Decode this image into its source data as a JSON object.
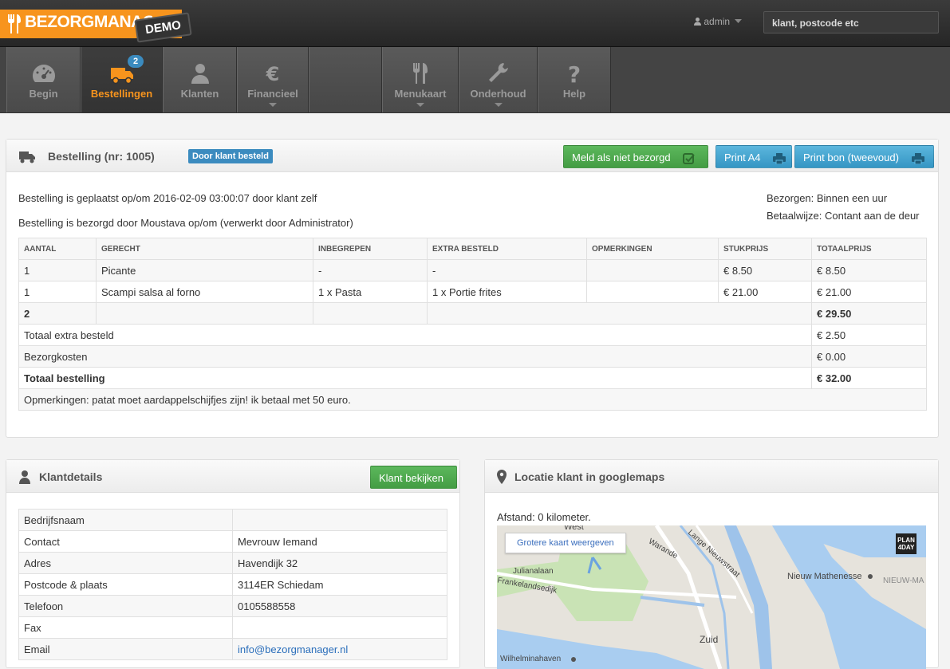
{
  "topbar": {
    "brand": "BEZORGMANAGER",
    "demo": "DEMO",
    "user": "admin",
    "search_placeholder": "klant, postcode etc"
  },
  "nav": {
    "items": [
      {
        "label": "Begin",
        "icon": "dashboard-icon"
      },
      {
        "label": "Bestellingen",
        "icon": "truck-icon",
        "badge": "2",
        "active": true
      },
      {
        "label": "Klanten",
        "icon": "user-icon"
      },
      {
        "label": "Financieel",
        "icon": "euro-icon"
      },
      {
        "label": "Menukaart",
        "icon": "cutlery-icon"
      },
      {
        "label": "Onderhoud",
        "icon": "wrench-icon"
      },
      {
        "label": "Help",
        "icon": "question-icon"
      }
    ]
  },
  "order": {
    "title": "Bestelling (nr: 1005)",
    "status_label": "Door klant besteld",
    "btn_not_delivered": "Meld als niet bezorgd",
    "btn_print_a4": "Print A4",
    "btn_print_receipt": "Print bon (tweevoud)",
    "placed_text": "Bestelling is geplaatst op/om 2016-02-09 03:00:07 door klant zelf",
    "delivered_text": "Bestelling is bezorgd door Moustava op/om (verwerkt door Administrator)",
    "delivery": "Bezorgen: Binnen een uur",
    "payment": "Betaalwijze: Contant aan de deur",
    "columns": [
      "AANTAL",
      "GERECHT",
      "INBEGREPEN",
      "EXTRA BESTELD",
      "OPMERKINGEN",
      "STUKPRIJS",
      "TOTAALPRIJS"
    ],
    "rows": [
      [
        "1",
        "Picante",
        "-",
        "-",
        "",
        "€ 8.50",
        "€ 8.50"
      ],
      [
        "1",
        "Scampi salsa al forno",
        "1 x Pasta",
        "1 x Portie frites",
        "",
        "€ 21.00",
        "€ 21.00"
      ]
    ],
    "subtotal_qty": "2",
    "subtotal": "€ 29.50",
    "extra_label": "Totaal extra besteld",
    "extra_value": "€ 2.50",
    "delivery_cost_label": "Bezorgkosten",
    "delivery_cost_value": "€ 0.00",
    "total_label": "Totaal bestelling",
    "total_value": "€ 32.00",
    "remarks": "Opmerkingen: patat moet aardappelschijfjes zijn! ik betaal met 50 euro."
  },
  "customer": {
    "title": "Klantdetails",
    "btn_view": "Klant bekijken",
    "rows": [
      {
        "label": "Bedrijfsnaam",
        "value": ""
      },
      {
        "label": "Contact",
        "value": "Mevrouw Iemand"
      },
      {
        "label": "Adres",
        "value": "Havendijk 32"
      },
      {
        "label": "Postcode & plaats",
        "value": "3114ER Schiedam"
      },
      {
        "label": "Telefoon",
        "value": "0105588558"
      },
      {
        "label": "Fax",
        "value": ""
      },
      {
        "label": "Email",
        "value": "info@bezorgmanager.nl"
      }
    ]
  },
  "map": {
    "title": "Locatie klant in googlemaps",
    "distance": "Afstand: 0 kilometer.",
    "btn_larger": "Grotere kaart weergeven",
    "labels": [
      "West",
      "Warande",
      "Lange Nieuwstraat",
      "Julianalaan",
      "Frankelandsedijk",
      "Nieuw Mathenesse",
      "NIEUW-MA",
      "Zuid",
      "Wilhelminahaven"
    ],
    "badge": "PLAN 4DAY"
  },
  "colors": {
    "accent": "#f7941d",
    "green": "#5cb85c",
    "blue": "#3b8bbf"
  }
}
